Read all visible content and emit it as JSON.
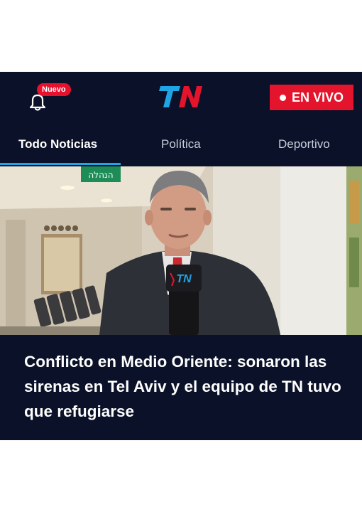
{
  "header": {
    "notification_badge": "Nuevo",
    "logo_text": "TN",
    "live_button_label": "EN VIVO",
    "colors": {
      "background": "#0a1128",
      "live_red": "#e3142b",
      "logo_blue": "#1fa4e6",
      "logo_red": "#e3142b"
    }
  },
  "tabs": [
    {
      "label": "Todo Noticias",
      "active": true
    },
    {
      "label": "Política",
      "active": false
    },
    {
      "label": "Deportivo",
      "active": false
    }
  ],
  "photo": {
    "sign_text": "הנהלה",
    "mic_text": "TN"
  },
  "article": {
    "headline": "Conflicto en Medio Oriente: sonaron las sirenas en Tel Aviv y el equipo de TN tuvo que refugiarse"
  }
}
